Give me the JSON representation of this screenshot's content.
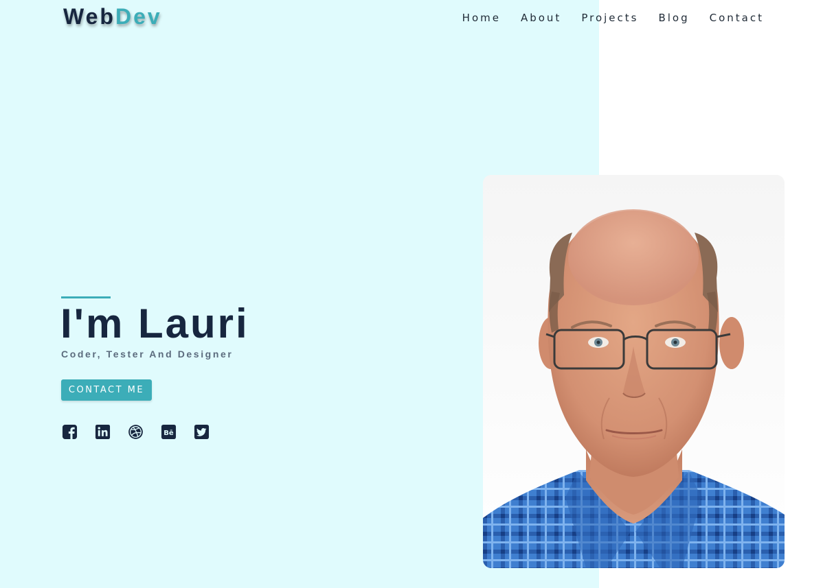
{
  "brand": {
    "logo_part_a": "Web",
    "logo_part_b": "Dev"
  },
  "nav": {
    "items": [
      {
        "label": "Home"
      },
      {
        "label": "About"
      },
      {
        "label": "Projects"
      },
      {
        "label": "Blog"
      },
      {
        "label": "Contact"
      }
    ]
  },
  "hero": {
    "title": "I'm Lauri",
    "subtitle": "Coder, Tester And Designer",
    "cta_label": "CONTACT ME",
    "socials": [
      {
        "icon": "facebook-icon"
      },
      {
        "icon": "linkedin-icon"
      },
      {
        "icon": "dribbble-icon"
      },
      {
        "icon": "behance-icon"
      },
      {
        "icon": "twitter-icon"
      }
    ]
  },
  "colors": {
    "hero_background": "#e0fbfd",
    "accent": "#3cadb8",
    "heading": "#17263f",
    "subtitle": "#5b6b7d"
  }
}
